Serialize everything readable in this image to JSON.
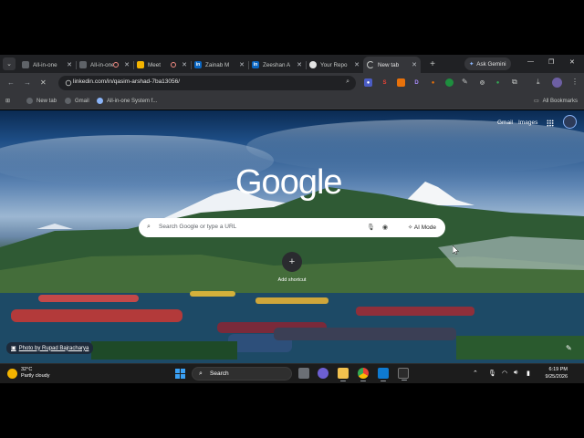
{
  "browser": {
    "tabs": [
      {
        "title": "All-in-one",
        "favicon": "globe-icon",
        "active": false
      },
      {
        "title": "All-in-one",
        "favicon": "globe-icon",
        "active": false,
        "recording": true
      },
      {
        "title": "Meet",
        "favicon": "meet-icon",
        "active": false,
        "recording": true
      },
      {
        "title": "Zainab M",
        "favicon": "linkedin-icon",
        "active": false
      },
      {
        "title": "Zeeshan A",
        "favicon": "linkedin-icon",
        "active": false
      },
      {
        "title": "Your Repo",
        "favicon": "github-icon",
        "active": false
      },
      {
        "title": "New tab",
        "favicon": "loading-icon",
        "active": true
      }
    ],
    "gemini_label": "Ask Gemini",
    "url": "linkedin.com/in/qasim-arshad-7ba13056/",
    "bookmarks": [
      {
        "label": "New tab"
      },
      {
        "label": "Gmail"
      },
      {
        "label": "All-in-one System f..."
      }
    ],
    "all_bookmarks_label": "All Bookmarks"
  },
  "newtab": {
    "gmail_link": "Gmail",
    "images_link": "Images",
    "logo_text": "Google",
    "search_placeholder": "Search Google or type a URL",
    "ai_mode_label": "AI Mode",
    "add_shortcut_label": "Add shortcut",
    "photo_credit": "Photo by Rupad Bajracharya"
  },
  "taskbar": {
    "weather_temp": "32°C",
    "weather_desc": "Partly cloudy",
    "search_label": "Search",
    "time": "6:19 PM",
    "date": "9/25/2026"
  },
  "colors": {
    "tabstrip": "#202124",
    "toolbar": "#35363a",
    "accent": "#8ab4f8",
    "linkedin": "#0a66c2"
  }
}
